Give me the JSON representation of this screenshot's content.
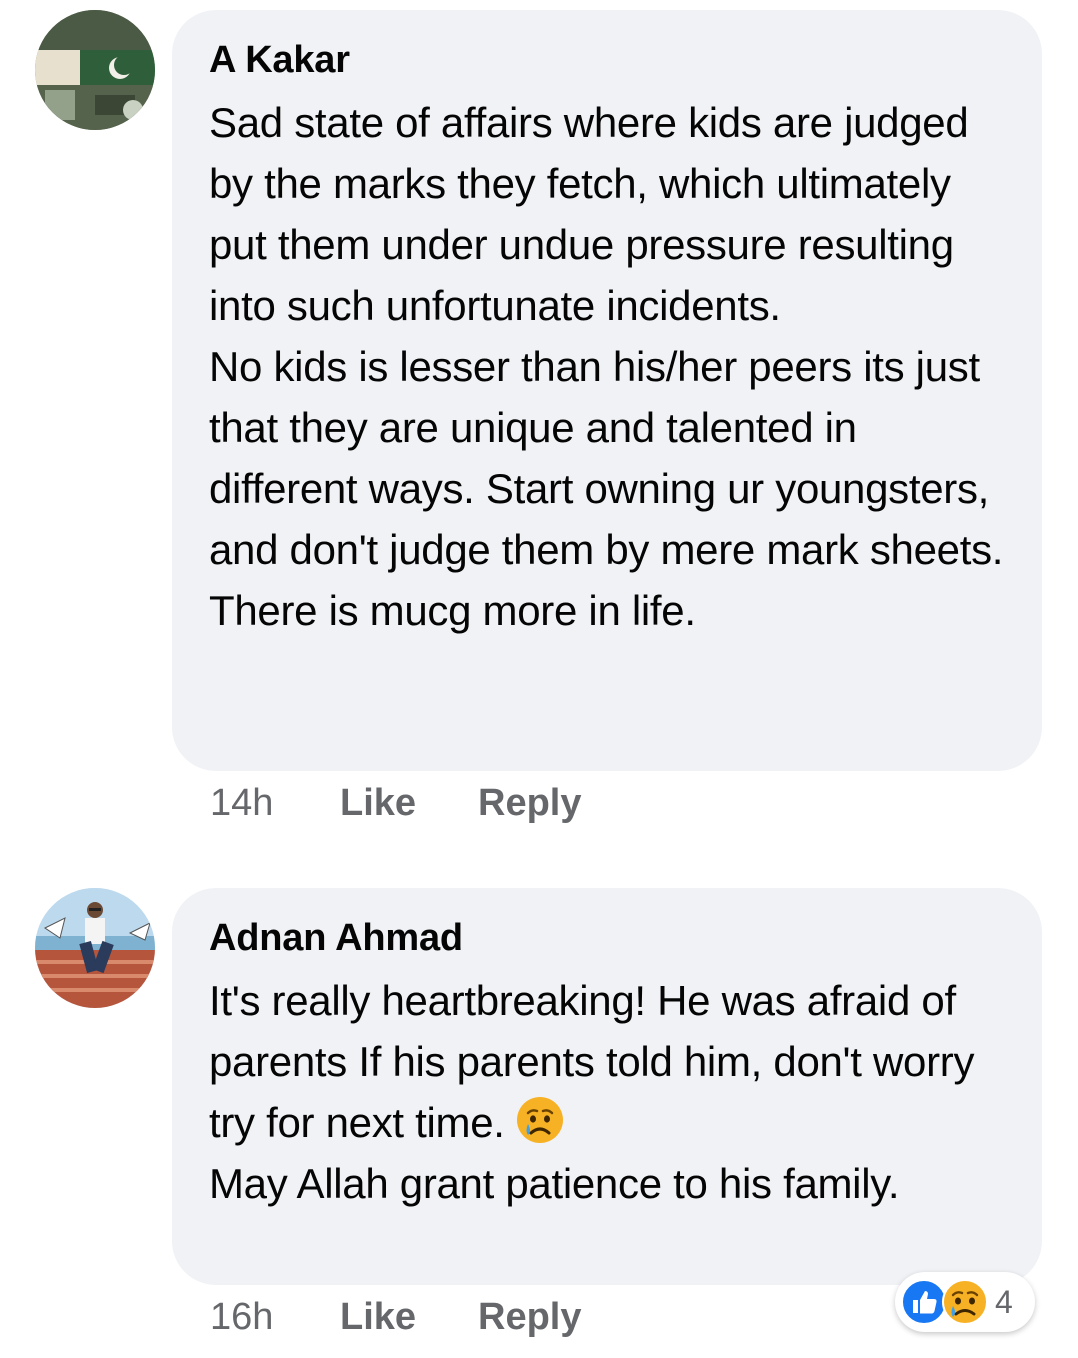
{
  "comments": [
    {
      "author": "A Kakar",
      "paragraphs": [
        "Sad state of affairs where kids are judged by the marks they fetch, which ultimately put them under undue pressure resulting into such unfortunate incidents.",
        "No kids is lesser than his/her peers its just that they are unique and talented in different ways. Start owning ur youngsters, and don't judge them by mere mark sheets. There is mucg more in life."
      ],
      "time": "14h",
      "like_label": "Like",
      "reply_label": "Reply"
    },
    {
      "author": "Adnan Ahmad",
      "paragraphs": [
        "It's really heartbreaking! He was afraid of parents If his parents told him, don't worry try for next time.",
        "May Allah grant patience to his family."
      ],
      "emoji": "sad-crying-emoji",
      "time": "16h",
      "like_label": "Like",
      "reply_label": "Reply",
      "reactions": {
        "types": [
          "like",
          "sad"
        ],
        "count": "4"
      }
    }
  ],
  "colors": {
    "bubble_bg": "#f0f2f5",
    "meta_text": "#65676b",
    "like_blue": "#1877f2",
    "emoji_yellow": "#f7b125"
  }
}
